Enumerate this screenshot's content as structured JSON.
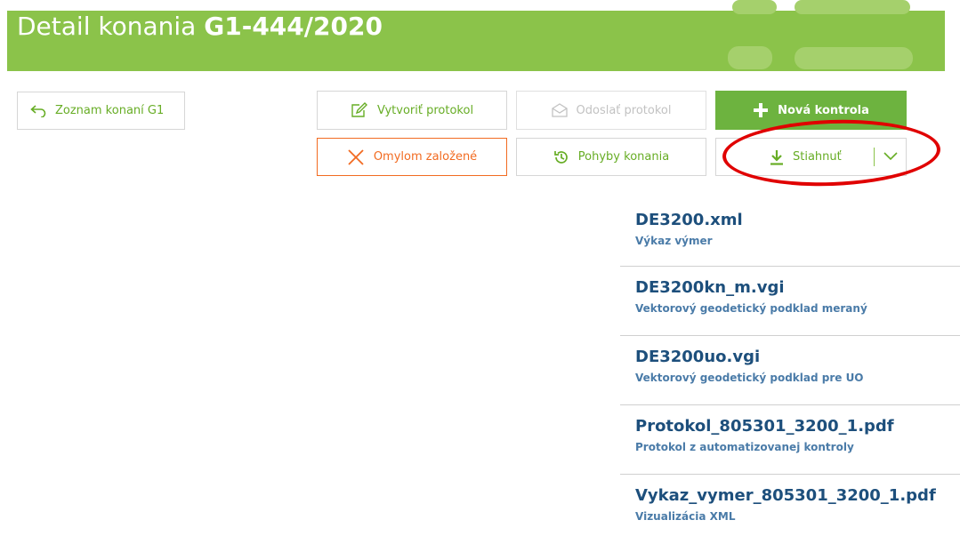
{
  "header": {
    "title_prefix": "Detail konania",
    "title_code": "G1-444/2020"
  },
  "toolbar": {
    "back_label": "Zoznam konaní G1",
    "create_protocol_label": "Vytvoriť protokol",
    "send_protocol_label": "Odoslať protokol",
    "new_control_label": "Nová kontrola",
    "mistake_label": "Omylom založené",
    "moves_label": "Pohyby konania",
    "download_label": "Stiahnuť"
  },
  "files": [
    {
      "name": "DE3200.xml",
      "desc": "Výkaz výmer"
    },
    {
      "name": "DE3200kn_m.vgi",
      "desc": "Vektorový geodetický podklad meraný"
    },
    {
      "name": "DE3200uo.vgi",
      "desc": "Vektorový geodetický podklad pre UO"
    },
    {
      "name": "Protokol_805301_3200_1.pdf",
      "desc": "Protokol z automatizovanej kontroly"
    },
    {
      "name": "Vykaz_vymer_805301_3200_1.pdf",
      "desc": "Vizualizácia XML"
    }
  ],
  "colors": {
    "header": "#8bc34a",
    "accent_green": "#67ad25",
    "primary_button": "#6db33f",
    "warning_orange": "#f26b21",
    "file_name": "#1d4f7c",
    "annotation_red": "#e00000"
  },
  "icons": {
    "back": "undo-arrow-icon",
    "create": "edit-icon",
    "send": "envelope-icon",
    "new": "plus-icon",
    "mistake": "close-icon",
    "moves": "history-icon",
    "download": "download-icon",
    "dropdown": "chevron-down-icon"
  }
}
